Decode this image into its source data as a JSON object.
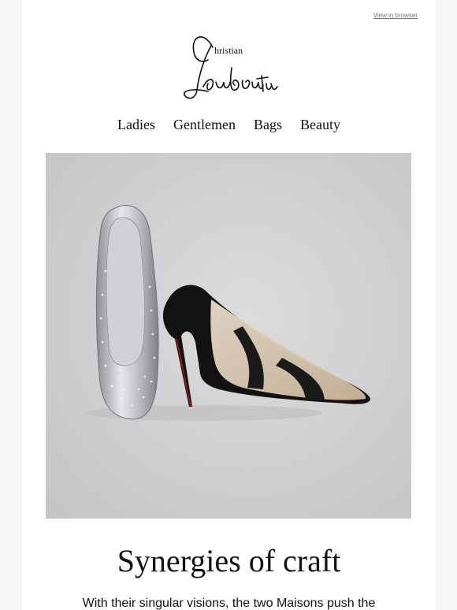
{
  "header": {
    "view_in_browser": "View in browser",
    "logo_text": "Christian Louboutin"
  },
  "nav": {
    "items": [
      "Ladies",
      "Gentlemen",
      "Bags",
      "Beauty"
    ]
  },
  "hero": {
    "image_alt": "Two shoes: a silver crystal-studded flat and a black and nude pointed pump",
    "background_color": "#d0d0d2"
  },
  "content": {
    "headline": "Synergies of craft",
    "body": "With their singular visions, the two Maisons push the"
  }
}
